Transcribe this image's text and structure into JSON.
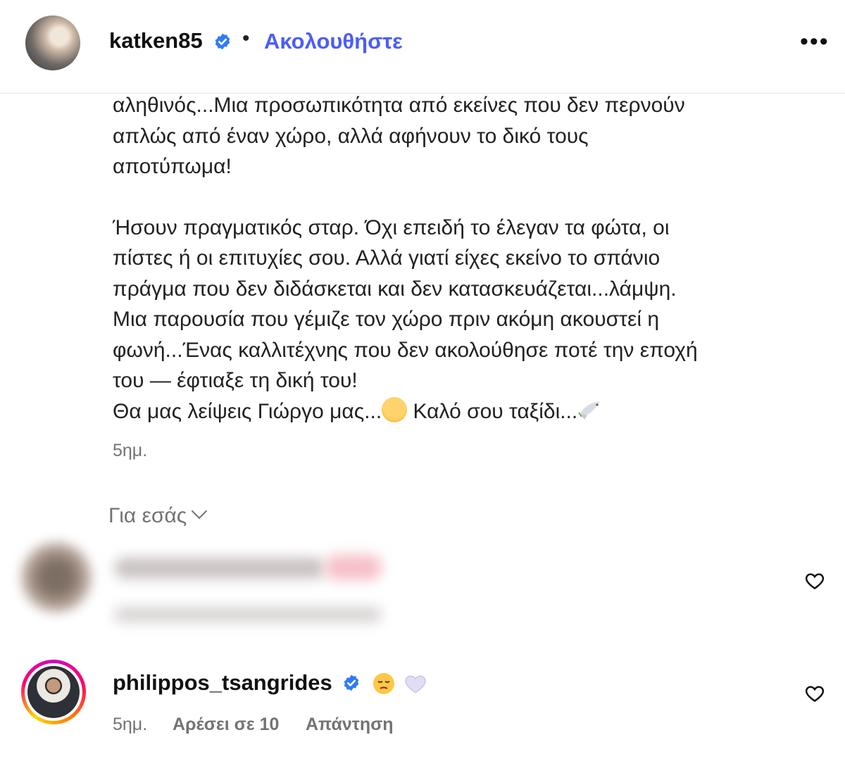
{
  "header": {
    "username": "katken85",
    "separator": "•",
    "follow_label": "Ακολουθήστε",
    "more_label": "•••"
  },
  "caption": {
    "paragraph1": "αληθινός...Μια προσωπικότητα από εκείνες που δεν περνούν\nαπλώς από έναν χώρο, αλλά αφήνουν το δικό τους\nαποτύπωμα!",
    "paragraph2": "Ήσουν πραγματικός σταρ. Όχι επειδή το έλεγαν τα φώτα, οι\nπίστες ή οι επιτυχίες σου. Αλλά γιατί είχες εκείνο το σπάνιο\nπράγμα που δεν διδάσκεται και δεν κατασκευάζεται...λάμψη.\nΜια παρουσία που γέμιζε τον χώρο πριν ακόμη ακουστεί η\nφωνή...Ένας καλλιτέχνης που δεν ακολούθησε ποτέ την εποχή\nτου — έφτιαξε τη δική του!",
    "last_line_part1": "Θα μας λείψεις Γιώργο μας...",
    "last_line_part2": " Καλό σου ταξίδι...",
    "timestamp": "5ημ."
  },
  "filter": {
    "label": "Για εσάς"
  },
  "comments": [
    {
      "username": "philippos_tsangrides",
      "timestamp": "5ημ.",
      "likes": "Αρέσει σε 10",
      "reply": "Απάντηση"
    }
  ],
  "icons": {
    "verified": "verified-badge-icon",
    "heart": "heart-icon",
    "more": "more-options-icon",
    "chevron": "chevron-down-icon"
  },
  "colors": {
    "accent": "#4a5df9",
    "verified": "#2f7bf6",
    "muted": "#737373"
  }
}
